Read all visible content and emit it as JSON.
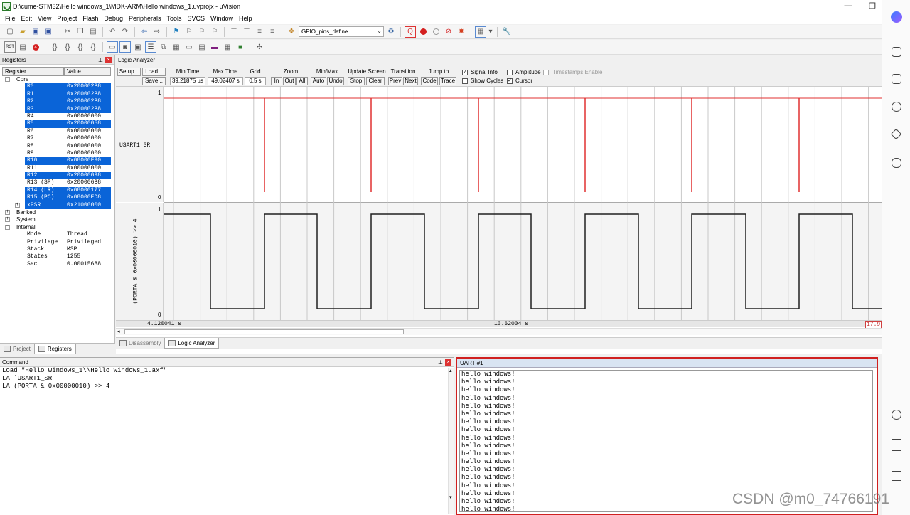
{
  "window": {
    "title": "D:\\cume-STM32\\Hello windows_1\\MDK-ARM\\Hello windows_1.uvprojx - µVision",
    "minimize_glyph": "—",
    "restore_glyph": "❐"
  },
  "menu": [
    "File",
    "Edit",
    "View",
    "Project",
    "Flash",
    "Debug",
    "Peripherals",
    "Tools",
    "SVCS",
    "Window",
    "Help"
  ],
  "toolbar": {
    "target_combo": "GPIO_pins_define",
    "reset_label": "RST",
    "colors": {
      "breakpoint": "#d42020",
      "run_stop": "#d42020"
    }
  },
  "registers": {
    "title": "Registers",
    "col_register": "Register",
    "col_value": "Value",
    "group_core": "Core",
    "rows": [
      {
        "name": "R0",
        "value": "0x200002B8",
        "selected": true
      },
      {
        "name": "R1",
        "value": "0x200002B8",
        "selected": true
      },
      {
        "name": "R2",
        "value": "0x200002B8",
        "selected": true
      },
      {
        "name": "R3",
        "value": "0x200002B8",
        "selected": true
      },
      {
        "name": "R4",
        "value": "0x00000000",
        "selected": false
      },
      {
        "name": "R5",
        "value": "0x20000058",
        "selected": true
      },
      {
        "name": "R6",
        "value": "0x00000000",
        "selected": false
      },
      {
        "name": "R7",
        "value": "0x00000000",
        "selected": false
      },
      {
        "name": "R8",
        "value": "0x00000000",
        "selected": false
      },
      {
        "name": "R9",
        "value": "0x00000000",
        "selected": false
      },
      {
        "name": "R10",
        "value": "0x08000F90",
        "selected": true
      },
      {
        "name": "R11",
        "value": "0x00000000",
        "selected": false
      },
      {
        "name": "R12",
        "value": "0x20000098",
        "selected": true
      },
      {
        "name": "R13 (SP)",
        "value": "0x200006B8",
        "selected": false
      },
      {
        "name": "R14 (LR)",
        "value": "0x08000177",
        "selected": true
      },
      {
        "name": "R15 (PC)",
        "value": "0x08000ED8",
        "selected": true
      },
      {
        "name": "xPSR",
        "value": "0x21000000",
        "selected": true
      }
    ],
    "group_banked": "Banked",
    "group_system": "System",
    "group_internal": "Internal",
    "internal": [
      {
        "name": "Mode",
        "value": "Thread"
      },
      {
        "name": "Privilege",
        "value": "Privileged"
      },
      {
        "name": "Stack",
        "value": "MSP"
      },
      {
        "name": "States",
        "value": "1255"
      },
      {
        "name": "Sec",
        "value": "0.00015688"
      }
    ],
    "tab_project": "Project",
    "tab_registers": "Registers"
  },
  "logic_analyzer": {
    "title": "Logic Analyzer",
    "setup": "Setup...",
    "load": "Load...",
    "save": "Save...",
    "min_time_label": "Min Time",
    "min_time": "39.21875 us",
    "max_time_label": "Max Time",
    "max_time": "49.02407 s",
    "grid_label": "Grid",
    "grid": "0.5 s",
    "zoom_label": "Zoom",
    "zoom_in": "In",
    "zoom_out": "Out",
    "zoom_all": "All",
    "minmax_label": "Min/Max",
    "minmax_auto": "Auto",
    "minmax_undo": "Undo",
    "update_label": "Update Screen",
    "update_stop": "Stop",
    "update_clear": "Clear",
    "transition_label": "Transition",
    "transition_prev": "Prev",
    "transition_next": "Next",
    "jump_label": "Jump to",
    "jump_code": "Code",
    "jump_trace": "Trace",
    "signal_info": "Signal Info",
    "show_cycles": "Show Cycles",
    "amplitude": "Amplitude",
    "cursor": "Cursor",
    "timestamps": "Timestamps Enable",
    "signal_info_checked": true,
    "show_cycles_checked": false,
    "amplitude_checked": false,
    "cursor_checked": true,
    "timestamps_checked": false,
    "signal1_name": "USART1_SR",
    "signal2_name": "(PORTA & 0x00000010) >> 4",
    "axis_high": "1",
    "axis_low": "0",
    "time_left": "4.120041 s",
    "time_mid": "10.62004 s",
    "time_right": "17.9",
    "tab_disassembly": "Disassembly",
    "tab_logic": "Logic Analyzer",
    "colors": {
      "signal1": "#e03030",
      "signal2": "#202020",
      "grid": "#c8c8c8"
    }
  },
  "command": {
    "title": "Command",
    "lines": [
      "Load \"Hello windows_1\\\\Hello windows_1.axf\"",
      "LA `USART1_SR",
      "LA (PORTA & 0x00000010) >> 4"
    ]
  },
  "uart": {
    "title": "UART #1",
    "lines": [
      "hello windows!",
      "hello windows!",
      "hello windows!",
      "hello windows!",
      "hello windows!",
      "hello windows!",
      "hello windows!",
      "hello windows!",
      "hello windows!",
      "hello windows!",
      "hello windows!",
      "hello windows!",
      "hello windows!",
      "hello windows!",
      "hello windows!",
      "hello windows!",
      "hello windows!",
      "hello windows!"
    ]
  },
  "watermark": "CSDN @m0_74766191"
}
